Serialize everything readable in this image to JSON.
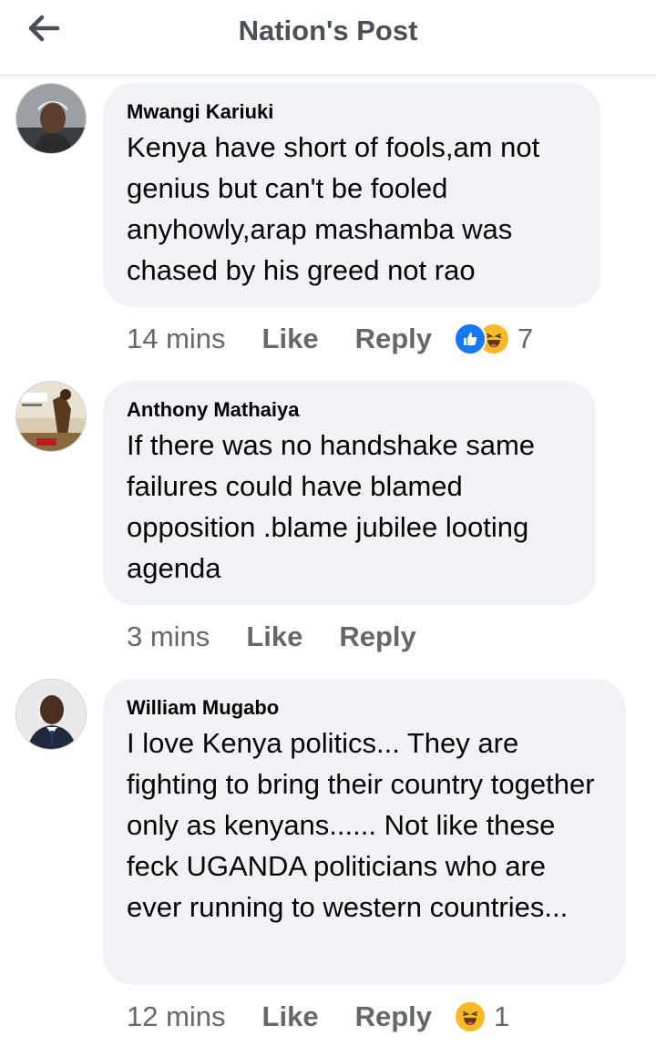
{
  "header": {
    "title": "Nation's Post",
    "back_icon": "arrow-left-icon"
  },
  "comments": [
    {
      "author": "Mwangi Kariuki",
      "text": "Kenya have short of fools,am not genius but can't be fooled anyhowly,arap mashamba was chased by his greed not rao",
      "time": "14 mins",
      "like_label": "Like",
      "reply_label": "Reply",
      "reactions": [
        "like-reaction-icon",
        "haha-reaction-icon"
      ],
      "reaction_count": "7"
    },
    {
      "author": "Anthony Mathaiya",
      "text": "If there was no handshake same failures could have blamed opposition .blame jubilee looting agenda",
      "time": "3 mins",
      "like_label": "Like",
      "reply_label": "Reply"
    },
    {
      "author": "William Mugabo",
      "text": "I love Kenya politics... They are fighting to bring their country together only as kenyans...... Not like these feck UGANDA politicians who are ever running to western countries...",
      "time": "12 mins",
      "like_label": "Like",
      "reply_label": "Reply",
      "reactions": [
        "haha-reaction-icon"
      ],
      "reaction_count": "1"
    }
  ],
  "colors": {
    "bubble": "#f0f2f5",
    "meta": "#65676b",
    "like_blue": "#1877f2",
    "haha_yellow": "#f7b928"
  }
}
